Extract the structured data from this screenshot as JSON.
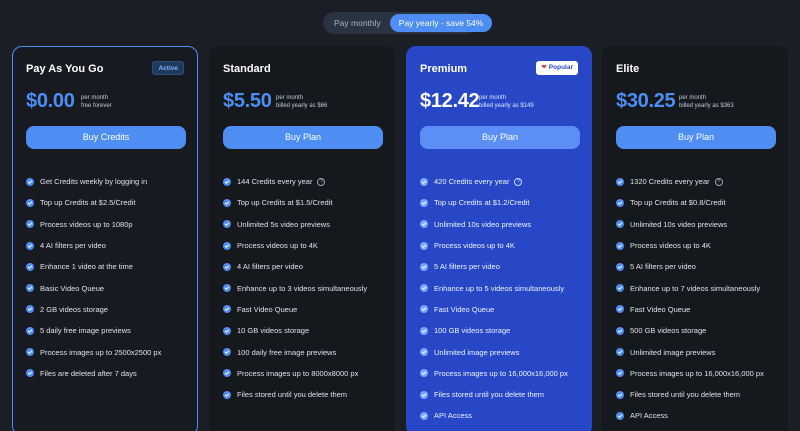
{
  "billing_toggle": {
    "monthly_label": "Pay monthly",
    "yearly_label": "Pay yearly - save 54%"
  },
  "plans": [
    {
      "name": "Pay As You Go",
      "badge": "Active",
      "price": "$0.00",
      "price_line1": "per month",
      "price_line2": "free forever",
      "cta": "Buy Credits",
      "features": [
        "Get Credits weekly by logging in",
        "Top up Credits at $2.5/Credit",
        "Process videos up to 1080p",
        "4 AI filters per video",
        "Enhance 1 video at the time",
        "Basic Video Queue",
        "2 GB videos storage",
        "5 daily free image previews",
        "Process images up to 2500x2500 px",
        "Files are deleted after 7 days"
      ]
    },
    {
      "name": "Standard",
      "price": "$5.50",
      "price_line1": "per month",
      "price_line2": "billed yearly as $66",
      "cta": "Buy Plan",
      "features": [
        "144 Credits every year",
        "Top up Credits at $1.5/Credit",
        "Unlimited 5s video previews",
        "Process videos up to 4K",
        "4 AI filters per video",
        "Enhance up to 3 videos simultaneously",
        "Fast Video Queue",
        "10 GB videos storage",
        "100 daily free image previews",
        "Process images up to 8000x8000 px",
        "Files stored until you delete them"
      ]
    },
    {
      "name": "Premium",
      "badge": "Popular",
      "price": "$12.42",
      "price_line1": "per month",
      "price_line2": "billed yearly as $149",
      "cta": "Buy Plan",
      "features": [
        "420 Credits every year",
        "Top up Credits at $1.2/Credit",
        "Unlimited 10s video previews",
        "Process videos up to 4K",
        "5 AI filters per video",
        "Enhance up to 5 videos simultaneously",
        "Fast Video Queue",
        "100 GB videos storage",
        "Unlimited image previews",
        "Process images up to 16,000x16,000 px",
        "Files stored until you delete them",
        "API Access"
      ]
    },
    {
      "name": "Elite",
      "price": "$30.25",
      "price_line1": "per month",
      "price_line2": "billed yearly as $363",
      "cta": "Buy Plan",
      "features": [
        "1320 Credits every year",
        "Top up Credits at $0.8/Credit",
        "Unlimited 10s video previews",
        "Process videos up to 4K",
        "5 AI filters per video",
        "Enhance up to 7 videos simultaneously",
        "Fast Video Queue",
        "500 GB videos storage",
        "Unlimited image previews",
        "Process images up to 16,000x16,000 px",
        "Files stored until you delete them",
        "API Access"
      ]
    }
  ],
  "colors": {
    "background": "#1b1e24",
    "card": "#15181d",
    "accent": "#4e8ef3",
    "premium_card": "#2847c7"
  },
  "icons": {
    "feature": "check-circle-icon",
    "info": "info-icon",
    "popular": "heart-icon"
  }
}
